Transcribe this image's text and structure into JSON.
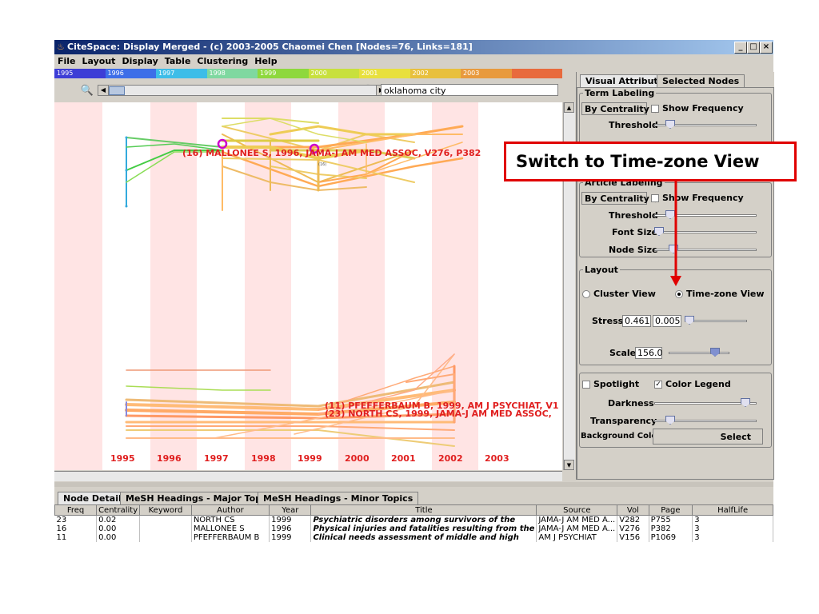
{
  "window": {
    "title": "CiteSpace: Display Merged - (c) 2003-2005 Chaomei Chen [Nodes=76, Links=181]",
    "minimize": "_",
    "maximize": "□",
    "close": "×"
  },
  "menu": [
    "File",
    "Layout",
    "Display",
    "Table",
    "Clustering",
    "Help"
  ],
  "year_strip": [
    {
      "label": "1995",
      "color": "#3d3dd6"
    },
    {
      "label": "1996",
      "color": "#3d6ee8"
    },
    {
      "label": "1997",
      "color": "#3dbde8"
    },
    {
      "label": "1998",
      "color": "#7fd8a0"
    },
    {
      "label": "1999",
      "color": "#8ed83d"
    },
    {
      "label": "2000",
      "color": "#c8e03d"
    },
    {
      "label": "2001",
      "color": "#e8e03d"
    },
    {
      "label": "2002",
      "color": "#e8c03d"
    },
    {
      "label": "2003",
      "color": "#e89a3d"
    },
    {
      "label": "",
      "color": "#e86a3d"
    }
  ],
  "toolbar": {
    "search_value": "oklahoma city",
    "zoom_out": "🔍",
    "zoom_in": "🔍"
  },
  "canvas": {
    "labels": [
      {
        "text": "(16) MALLONEE S, 1996, JAMA-J AM MED ASSOC, V276, P382"
      },
      {
        "text": "(11) PFEFFERBAUM B, 1999, AM J PSYCHIAT, V1"
      },
      {
        "text": "(23) NORTH CS, 1999, JAMA-J AM MED ASSOC,"
      }
    ],
    "small_label": "(16)",
    "timeline_years": [
      "1995",
      "1996",
      "1997",
      "1998",
      "1999",
      "2000",
      "2001",
      "2002",
      "2003"
    ]
  },
  "right_panel": {
    "tabs": [
      "Visual Attributes",
      "Selected Nodes"
    ],
    "term_labeling": {
      "legend": "Term Labeling",
      "combo": "By Centrality",
      "show_frequency": "Show Frequency",
      "threshold": "Threshold"
    },
    "article_labeling": {
      "legend": "Article Labeling",
      "combo": "By Centrality",
      "show_frequency": "Show Frequency",
      "threshold": "Threshold",
      "font_size": "Font Size",
      "node_size": "Node Size"
    },
    "layout": {
      "legend": "Layout",
      "cluster_view": "Cluster View",
      "time_zone_view": "Time-zone View",
      "stress_label": "Stress",
      "stress_a": "0.461",
      "stress_b": "0.005",
      "scale_label": "Scale",
      "scale_value": "156.0"
    },
    "display": {
      "spotlight": "Spotlight",
      "color_legend": "Color Legend",
      "darkness": "Darkness",
      "transparency": "Transparency",
      "background_color": "Background Color",
      "select": "Select"
    }
  },
  "callout": {
    "text": "Switch to Time-zone View"
  },
  "bottom_tabs": [
    "Node Details",
    "MeSH Headings - Major Topics",
    "MeSH Headings - Minor Topics"
  ],
  "table": {
    "headers": [
      "Freq",
      "Centrality",
      "Keyword",
      "Author",
      "Year",
      "Title",
      "Source",
      "Vol",
      "Page",
      "HalfLife"
    ],
    "rows": [
      [
        "23",
        "0.02",
        "",
        "NORTH CS",
        "1999",
        "Psychiatric disorders among survivors of the",
        "JAMA-J AM MED A...",
        "V282",
        "P755",
        "3"
      ],
      [
        "16",
        "0.00",
        "",
        "MALLONEE S",
        "1996",
        "Physical injuries and fatalities resulting from the",
        "JAMA-J AM MED A...",
        "V276",
        "P382",
        "3"
      ],
      [
        "11",
        "0.00",
        "",
        "PFEFFERBAUM B",
        "1999",
        "Clinical needs assessment of middle and high",
        "AM J PSYCHIAT",
        "V156",
        "P1069",
        "3"
      ]
    ]
  }
}
